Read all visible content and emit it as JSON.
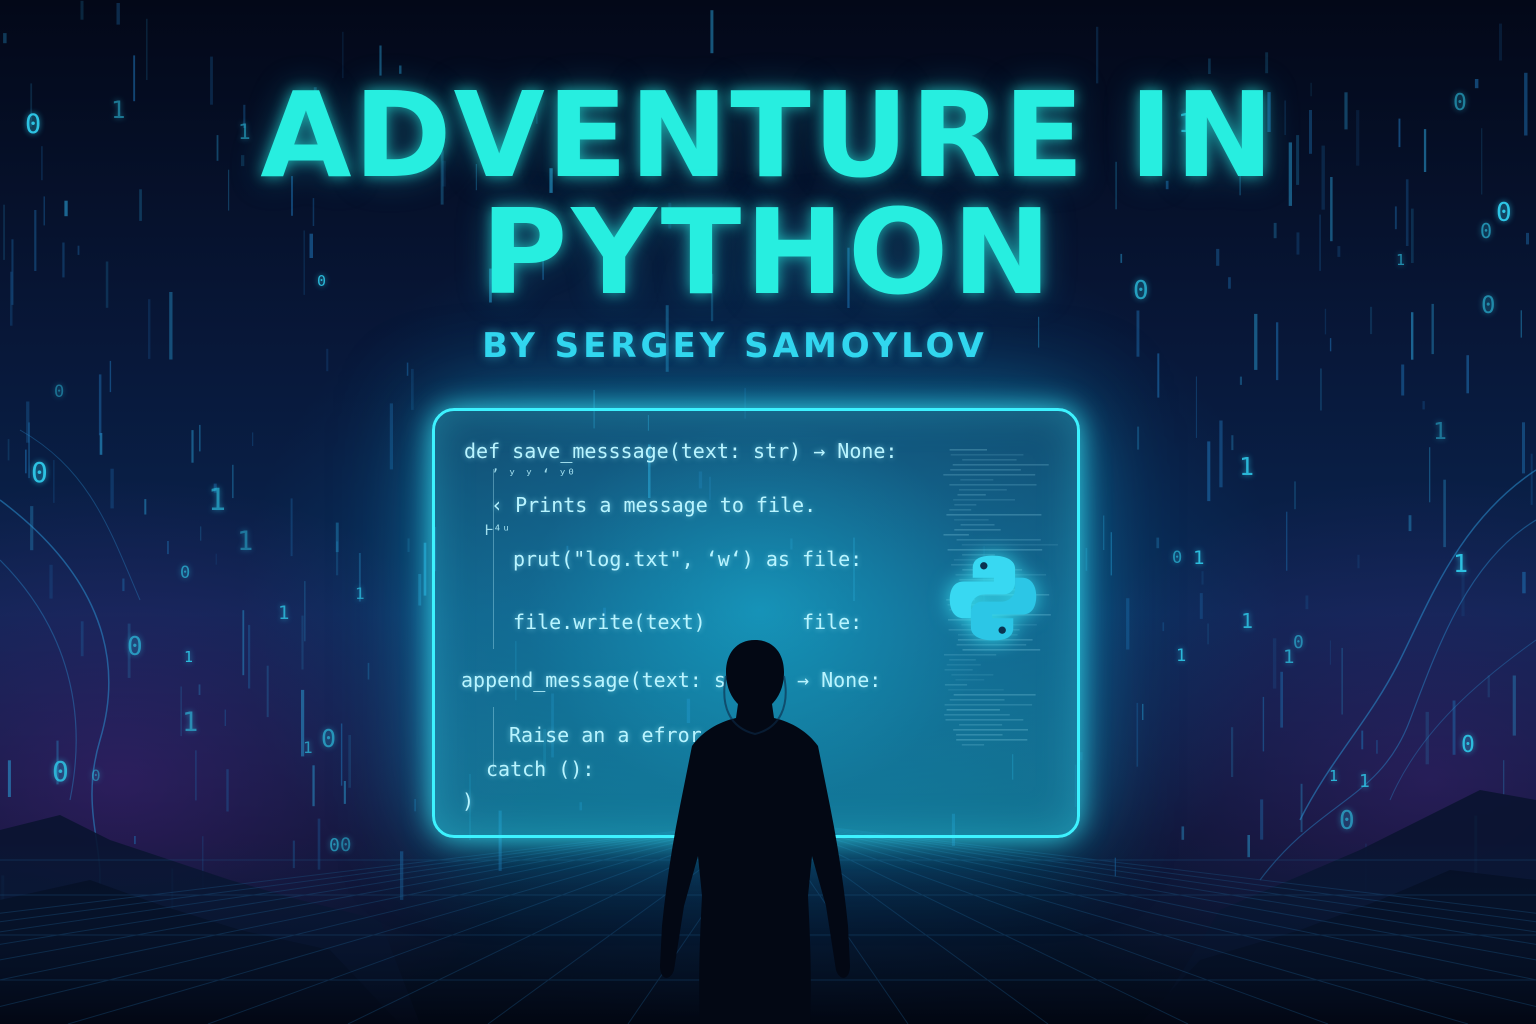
{
  "cover": {
    "title_line_1": "ADVENTURE IN",
    "title_line_2": "PYTHON",
    "subtitle": "BY SERGEY SAMOYLOV"
  },
  "code_panel": {
    "lines": [
      "def save_messsage(text: str) → None:",
      "ʼ ʸ ʸ ʻ ʸ⁰",
      "‹ Prints a message to file.",
      "Ⱶ⁴ᵘ",
      "prut(\"log.txt\", ‘w‘) as file:",
      "file.write(text)        file:",
      "append_message(text: s",
      "→ None:",
      "Raise an a efror )",
      "catch ():",
      ")"
    ],
    "logo": "python-logo-icon"
  },
  "background_digits": [
    "0",
    "1",
    "0",
    "1",
    "0",
    "1",
    "0",
    "1",
    "1",
    "0",
    "0",
    "1",
    "0",
    "1",
    "0",
    "1",
    "0",
    "1",
    "0",
    "1",
    "0",
    "1",
    "1",
    "0",
    "1",
    "0",
    "1",
    "0",
    "0",
    "1",
    "1",
    "0",
    "1",
    "0",
    "1",
    "0",
    "1",
    "0",
    "1",
    "0"
  ],
  "colors": {
    "accent": "#27eee0",
    "panel_border": "#3df2ff",
    "digits": "#2ec6e6",
    "background": "#040b1c"
  }
}
